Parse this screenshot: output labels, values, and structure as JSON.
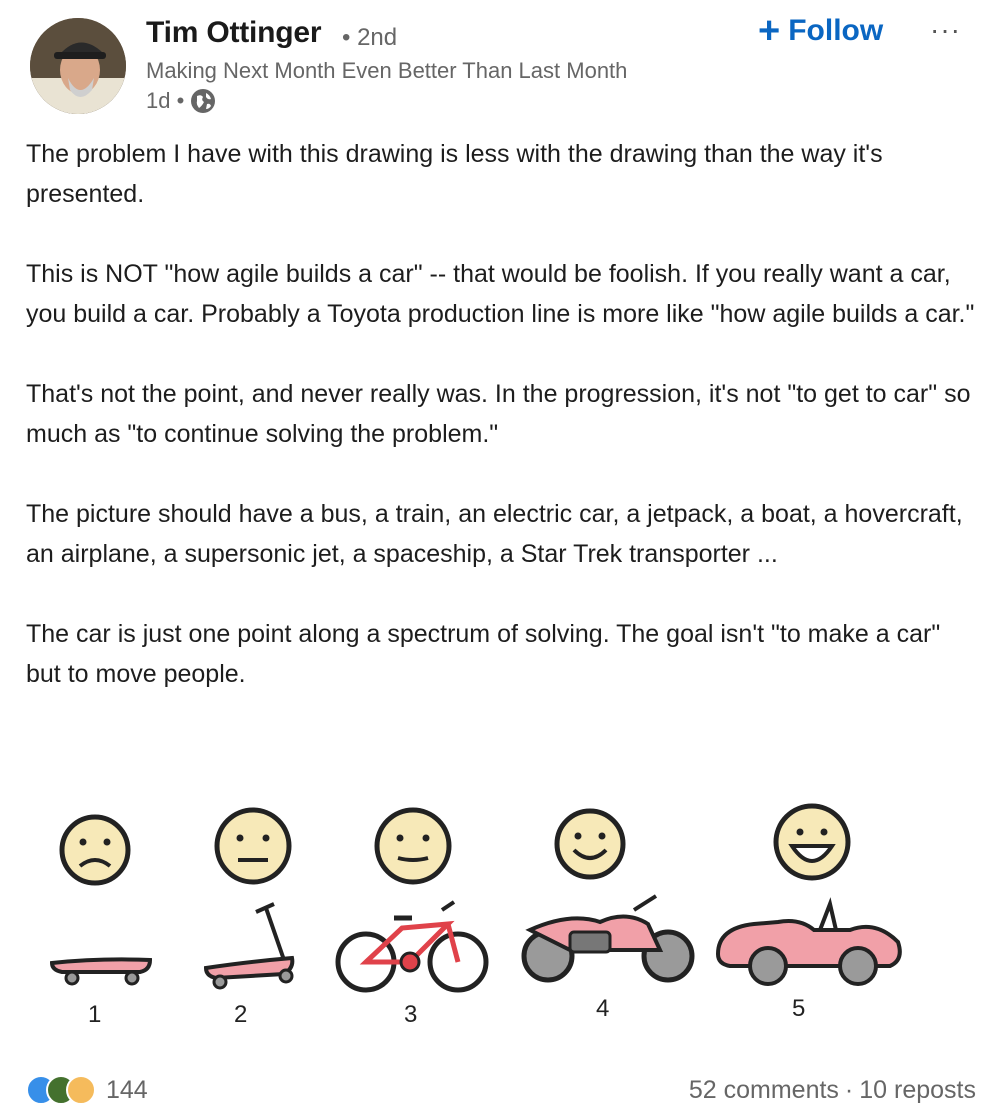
{
  "author": {
    "name": "Tim Ottinger",
    "degree": "• 2nd",
    "headline": "Making Next Month Even Better Than Last Month",
    "time": "1d •"
  },
  "actions": {
    "follow_plus": "+",
    "follow_label": "Follow",
    "more_label": "···"
  },
  "post": {
    "paragraphs": [
      "The problem I have with this drawing is less with the drawing than the way it's presented.",
      "This is NOT \"how agile builds a car\" -- that would be foolish. If you really want a car, you build a car. Probably a Toyota production line is more like \"how agile builds a car.\"",
      "That's not the point, and never really was. In the progression, it's not \"to get to car\" so much as \"to continue solving the problem.\"",
      "The picture should have a bus, a train, an electric car, a jetpack, a boat, a hovercraft, an airplane, a supersonic jet, a spaceship, a Star Trek transporter ...",
      "The car is just one point along a spectrum of solving. The goal isn't \"to make a car\" but to move people."
    ]
  },
  "illustration": {
    "stages": [
      "1",
      "2",
      "3",
      "4",
      "5"
    ],
    "colors": {
      "face": "#f7e9b8",
      "vehicle": "#f1a0a8",
      "wheel": "#9a9a9a",
      "outline": "#222222"
    }
  },
  "footer": {
    "reaction_icons": [
      "like-icon",
      "celebrate-icon",
      "insightful-icon"
    ],
    "reaction_count": "144",
    "comments": "52 comments",
    "separator": "·",
    "reposts": "10 reposts"
  }
}
